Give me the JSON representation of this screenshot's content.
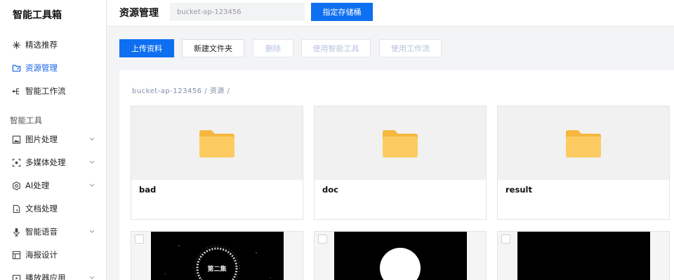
{
  "sidebar": {
    "app_title": "智能工具箱",
    "items": [
      {
        "label": "精选推荐",
        "icon": "sparkle-icon",
        "active": false
      },
      {
        "label": "资源管理",
        "icon": "folder-link-icon",
        "active": true
      },
      {
        "label": "智能工作流",
        "icon": "workflow-icon",
        "active": false
      }
    ],
    "section_label": "智能工具",
    "tools": [
      {
        "label": "图片处理",
        "icon": "image-icon",
        "expandable": true
      },
      {
        "label": "多媒体处理",
        "icon": "media-icon",
        "expandable": true
      },
      {
        "label": "AI处理",
        "icon": "ai-hexagon-icon",
        "expandable": true
      },
      {
        "label": "文档处理",
        "icon": "document-icon",
        "expandable": false
      },
      {
        "label": "智能语音",
        "icon": "microphone-icon",
        "expandable": true
      },
      {
        "label": "海报设计",
        "icon": "poster-icon",
        "expandable": false
      },
      {
        "label": "播放器应用",
        "icon": "player-icon",
        "expandable": true
      }
    ]
  },
  "header": {
    "title": "资源管理",
    "bucket_value": "bucket-ap-123456",
    "bucket_button": "指定存储桶"
  },
  "toolbar": {
    "upload": "上传资料",
    "new_folder": "新建文件夹",
    "delete": "删除",
    "use_tool": "使用智能工具",
    "use_workflow": "使用工作流"
  },
  "content": {
    "path": "bucket-ap-123456 / 资源 /",
    "folders": [
      "bad",
      "doc",
      "result"
    ],
    "thumb_text": "第二集"
  },
  "colors": {
    "accent": "#0e6ff0",
    "folder": "#fbc95b"
  }
}
